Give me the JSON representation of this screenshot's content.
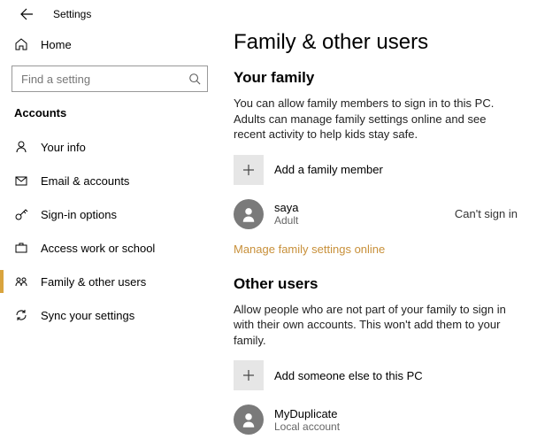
{
  "header": {
    "title": "Settings"
  },
  "sidebar": {
    "home_label": "Home",
    "search_placeholder": "Find a setting",
    "category": "Accounts",
    "items": [
      {
        "label": "Your info"
      },
      {
        "label": "Email & accounts"
      },
      {
        "label": "Sign-in options"
      },
      {
        "label": "Access work or school"
      },
      {
        "label": "Family & other users"
      },
      {
        "label": "Sync your settings"
      }
    ]
  },
  "main": {
    "title": "Family & other users",
    "family": {
      "heading": "Your family",
      "desc": "You can allow family members to sign in to this PC. Adults can manage family settings online and see recent activity to help kids stay safe.",
      "add_label": "Add a family member",
      "member": {
        "name": "saya",
        "role": "Adult",
        "status": "Can't sign in"
      },
      "manage_link": "Manage family settings online"
    },
    "other": {
      "heading": "Other users",
      "desc": "Allow people who are not part of your family to sign in with their own accounts. This won't add them to your family.",
      "add_label": "Add someone else to this PC",
      "member": {
        "name": "MyDuplicate",
        "role": "Local account"
      }
    }
  }
}
